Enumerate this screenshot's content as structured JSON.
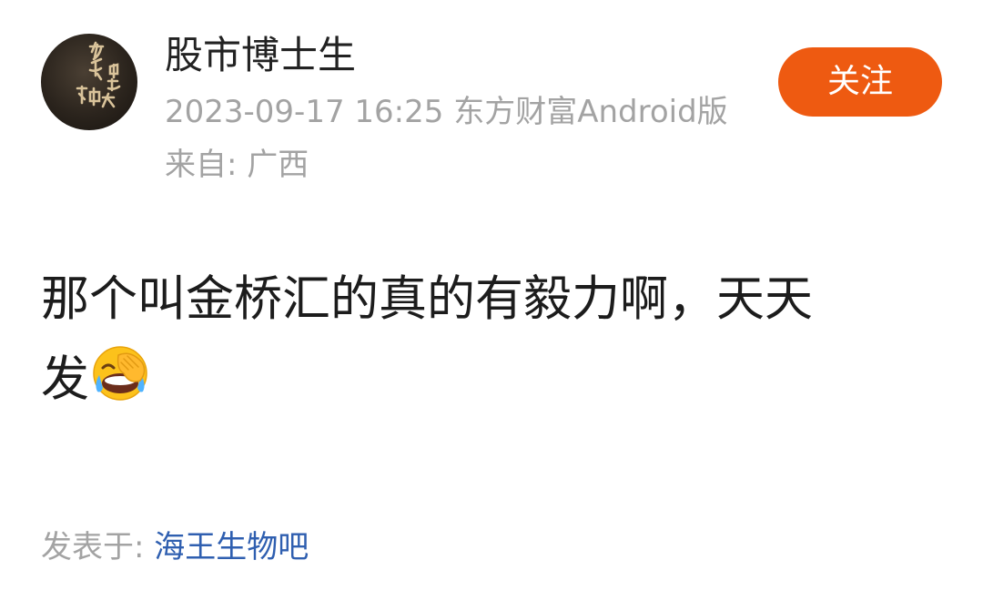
{
  "author": {
    "name": "股市博士生",
    "avatar_text": "我命由我 不由天"
  },
  "post_meta": {
    "timestamp": "2023-09-17 16:25",
    "source": "东方财富Android版",
    "location_label": "来自: 广西"
  },
  "follow_button": {
    "label": "关注",
    "color": "#ee5a11"
  },
  "content": {
    "line1": "那个叫金桥汇的真的有毅力啊，天天",
    "line2": "发",
    "emoji": "rolling-on-floor-laughing-emoji"
  },
  "footer": {
    "posted_in_label": "发表于:",
    "forum_name": "海王生物吧",
    "link_color": "#2f5fb0"
  }
}
